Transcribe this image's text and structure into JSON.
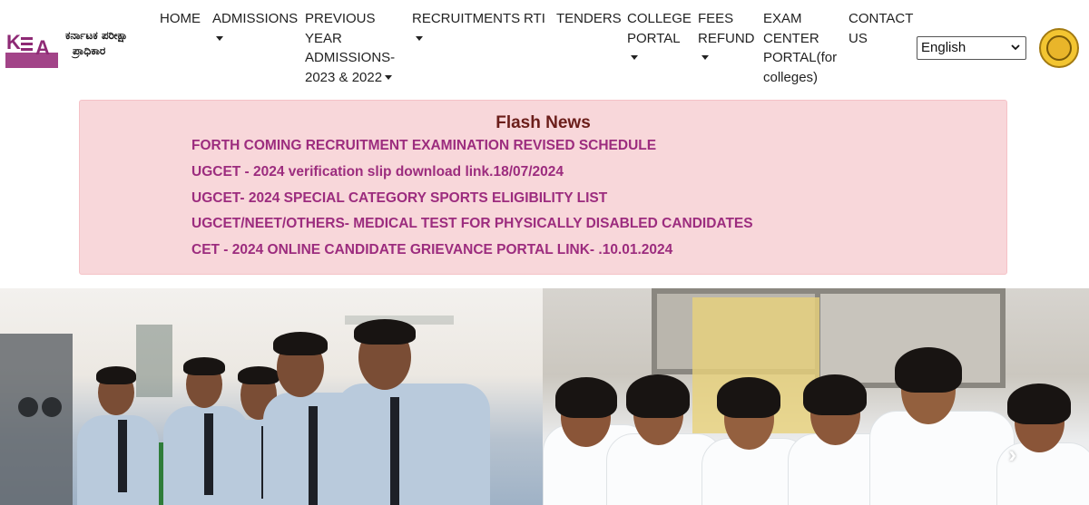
{
  "logo": {
    "letters": "KEA",
    "line1": "ಕರ್ನಾಟಕ ಪರೀಕ್ಷಾ",
    "line2": "ಪ್ರಾಧಿಕಾರ"
  },
  "nav": {
    "home": "HOME",
    "admissions": "ADMISSIONS",
    "previous_l1": "PREVIOUS",
    "previous_l2": "YEAR",
    "previous_l3": "ADMISSIONS-",
    "previous_l4": "2023 & 2022",
    "recruitments": "RECRUITMENTS",
    "rti": "RTI",
    "tenders": "TENDERS",
    "college_l1": "COLLEGE",
    "college_l2": "PORTAL",
    "fees_l1": "FEES",
    "fees_l2": "REFUND",
    "exam_l1": "EXAM",
    "exam_l2": "CENTER",
    "exam_l3": "PORTAL(for",
    "exam_l4": "colleges)",
    "contact_l1": "CONTACT",
    "contact_l2": "US"
  },
  "language": {
    "selected": "English"
  },
  "flash": {
    "title": "Flash News",
    "items": [
      "FORTH COMING RECRUITMENT EXAMINATION REVISED SCHEDULE",
      "UGCET - 2024 verification slip download link.18/07/2024",
      "UGCET- 2024 SPECIAL CATEGORY SPORTS ELIGIBILITY LIST",
      "UGCET/NEET/OTHERS- MEDICAL TEST FOR PHYSICALLY DISABLED CANDIDATES",
      "CET - 2024 ONLINE CANDIDATE GRIEVANCE PORTAL LINK- .10.01.2024"
    ]
  },
  "banner": {
    "next_arrow": "›"
  },
  "colors": {
    "flash_bg": "#f8d7da",
    "flash_title": "#6b1e1a",
    "flash_link": "#9c2c7e",
    "logo_purple": "#8e2a75"
  },
  "icons": {
    "emblem": "karnataka-emblem-icon",
    "caret": "caret-down-icon",
    "next": "chevron-right-icon"
  }
}
